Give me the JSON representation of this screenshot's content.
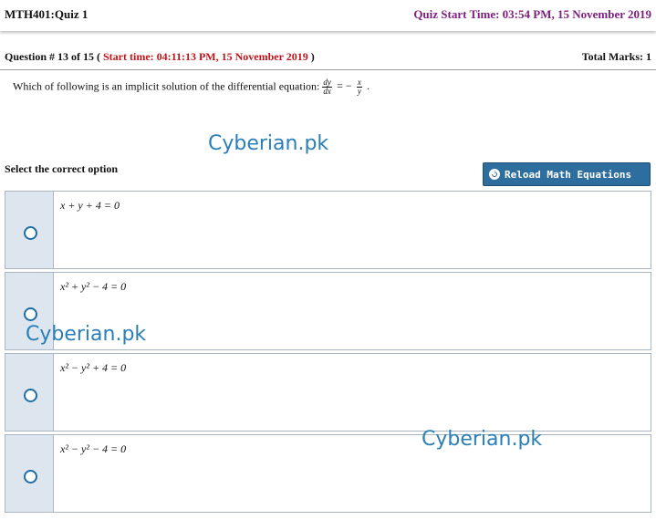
{
  "header": {
    "course": "MTH401:Quiz 1",
    "quiz_start": "Quiz Start Time: 03:54 PM, 15 November 2019"
  },
  "question_bar": {
    "number_prefix": "Question # 13 of 15 (",
    "start_time": "Start time: 04:11:13 PM, 15 November 2019",
    "number_suffix": ")",
    "total_marks": "Total Marks: 1"
  },
  "question": {
    "text": "Which of following is an implicit solution of the differential equation:",
    "eq_num": "dy",
    "eq_den": "dx",
    "eq_op": "= −",
    "rhs_num": "x",
    "rhs_den": "y",
    "eq_end": "."
  },
  "watermarks": [
    "Cyberian.pk",
    "Cyberian.pk",
    "Cyberian.pk"
  ],
  "select_label": "Select the correct option",
  "reload_button": "Reload Math Equations",
  "options": [
    {
      "text": "x + y + 4 = 0",
      "selected": false
    },
    {
      "text": "x² + y² − 4 = 0",
      "selected": false
    },
    {
      "text": "x² − y² + 4 = 0",
      "selected": false
    },
    {
      "text": "x² − y² − 4 = 0",
      "selected": false
    }
  ],
  "colors": {
    "accent": "#2d6e9e",
    "quiz_start": "#7d1e7e",
    "start_time": "#c0141a",
    "watermark": "#2a7fb8"
  }
}
